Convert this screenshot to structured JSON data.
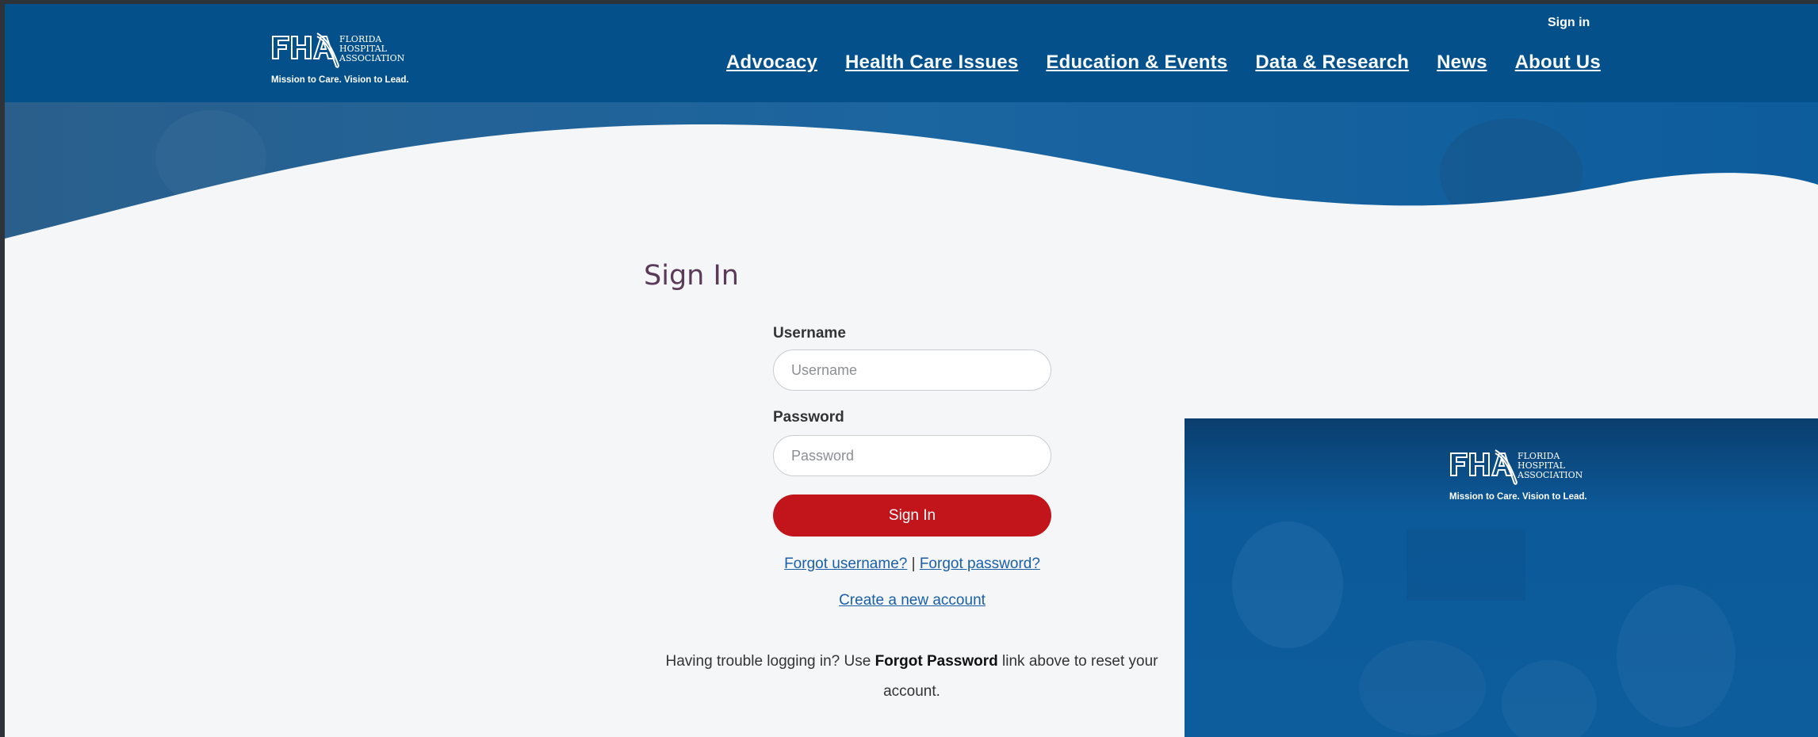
{
  "header": {
    "logo": {
      "org_line1": "FLORIDA",
      "org_line2": "HOSPITAL",
      "org_line3": "ASSOCIATION",
      "tagline": "Mission to Care. Vision to Lead."
    },
    "signin_link": "Sign in",
    "nav": [
      {
        "label": "Advocacy"
      },
      {
        "label": "Health Care Issues"
      },
      {
        "label": "Education & Events"
      },
      {
        "label": "Data & Research"
      },
      {
        "label": "News"
      },
      {
        "label": "About Us"
      }
    ]
  },
  "form": {
    "title": "Sign In",
    "username_label": "Username",
    "username_placeholder": "Username",
    "password_label": "Password",
    "password_placeholder": "Password",
    "submit_label": "Sign In",
    "forgot_username": "Forgot username?",
    "separator": "|",
    "forgot_password": "Forgot password?",
    "create_account": "Create a new account"
  },
  "help": {
    "prefix": "Having trouble logging in? Use ",
    "bold": "Forgot Password",
    "suffix": " link above to reset your account."
  },
  "panel": {
    "logo": {
      "org_line1": "FLORIDA",
      "org_line2": "HOSPITAL",
      "org_line3": "ASSOCIATION",
      "tagline": "Mission to Care. Vision to Lead."
    }
  },
  "colors": {
    "header_blue": "#03508a",
    "accent_red": "#c1141b",
    "title_purple": "#5a3a58",
    "link_blue": "#1a5fa8"
  }
}
